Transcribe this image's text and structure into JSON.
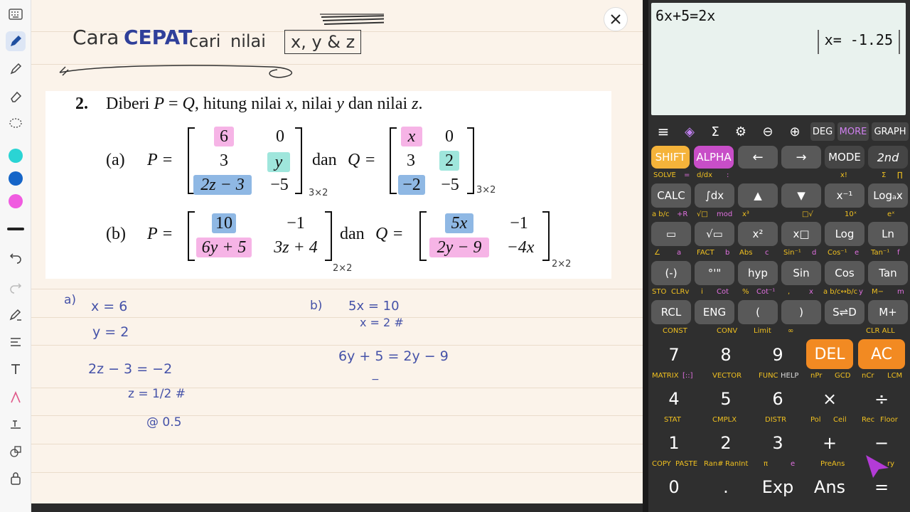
{
  "notes": {
    "title_handwriting": [
      "Cara",
      "CEPAT",
      "cari",
      "nilai",
      "x, y & z"
    ],
    "problem": {
      "number": "2.",
      "statement_parts": [
        "Diberi",
        "P",
        "=",
        "Q",
        ", hitung nilai",
        "x",
        ", nilai",
        "y",
        "dan nilai",
        "z",
        "."
      ],
      "part_a": {
        "label": "(a)",
        "p_label": "P =",
        "dan": "dan",
        "q_label": "Q =",
        "P": [
          "6",
          "0",
          "3",
          "y",
          "2z − 3",
          "−5"
        ],
        "Q": [
          "x",
          "0",
          "3",
          "2",
          "−2",
          "−5"
        ],
        "size_p": "3×2",
        "size_q": "3×2"
      },
      "part_b": {
        "label": "(b)",
        "p_label": "P =",
        "dan": "dan",
        "q_label": "Q =",
        "P": [
          "10",
          "−1",
          "6y + 5",
          "3z + 4"
        ],
        "Q": [
          "5x",
          "−1",
          "2y − 9",
          "−4x"
        ],
        "size_p": "2×2",
        "size_q": "2×2"
      }
    },
    "work_a": [
      "a)",
      "x = 6",
      "y = 2",
      "2z − 3 = −2",
      "z = 1/2 #",
      "@ 0.5"
    ],
    "work_b": [
      "b)",
      "5x = 10",
      "x = 2 #",
      "6y + 5 = 2y − 9",
      "−"
    ]
  },
  "toolbar": {
    "icons": [
      "keyboard-icon",
      "pen-icon",
      "highlighter-icon",
      "eraser-icon",
      "lasso-icon",
      "color-cyan",
      "color-blue",
      "color-pink",
      "stroke-width",
      "undo-icon",
      "redo-icon",
      "pen-settings-icon",
      "text-align-icon",
      "text-tool-icon",
      "shape-icon",
      "textbox-icon",
      "shapes-icon",
      "lock-icon"
    ],
    "colors": {
      "cyan": "#2ad4d4",
      "blue": "#1565c8",
      "pink": "#f05be0"
    }
  },
  "calculator": {
    "expression": "6x+5=2x",
    "result": "x= -1.25",
    "topbar": [
      "≡",
      "◈",
      "Σ",
      "⚙",
      "⊖",
      "⊕",
      "DEG",
      "MORE",
      "GRAPH"
    ],
    "row1": [
      "SHIFT",
      "ALPHA",
      "←",
      "→",
      "MODE",
      "2nd"
    ],
    "row1_labels": [
      "SOLVE",
      "=",
      "d/dx",
      ":",
      "x!",
      "Σ",
      "∏"
    ],
    "row2": [
      "CALC",
      "∫dx",
      "▲",
      "▼",
      "x⁻¹",
      "Logₐx"
    ],
    "row2_labels": [
      "a b/c",
      "+R",
      "√□",
      "mod",
      "x³",
      "□√",
      "10ˣ",
      "eˣ"
    ],
    "row3": [
      "▭",
      "√▭",
      "x²",
      "x□",
      "Log",
      "Ln"
    ],
    "row3_labels": [
      "∠",
      "a",
      "FACT",
      "b",
      "Abs",
      "c",
      "Sin⁻¹",
      "d",
      "Cos⁻¹",
      "e",
      "Tan⁻¹",
      "f"
    ],
    "row4": [
      "(-)",
      "°'\"",
      "hyp",
      "Sin",
      "Cos",
      "Tan"
    ],
    "row4_labels": [
      "STO",
      "CLRv",
      "i",
      "Cot",
      "%",
      "Cot⁻¹",
      ",",
      "x",
      "a b/c↔b/c",
      "y",
      "M−",
      "m"
    ],
    "row5": [
      "RCL",
      "ENG",
      "(",
      ")",
      "S⇌D",
      "M+"
    ],
    "row5_labels": [
      "CONST",
      "CONV",
      "Limit",
      "∞",
      "CLR ALL"
    ],
    "row6": [
      "7",
      "8",
      "9",
      "DEL",
      "AC"
    ],
    "row6_labels": [
      "MATRIX",
      "[::]",
      "VECTOR",
      "FUNC",
      "HELP",
      "nPr",
      "GCD",
      "nCr",
      "LCM"
    ],
    "row7": [
      "4",
      "5",
      "6",
      "×",
      "÷"
    ],
    "row7_labels": [
      "STAT",
      "CMPLX",
      "DISTR",
      "Pol",
      "Ceil",
      "Rec",
      "Floor"
    ],
    "row8": [
      "1",
      "2",
      "3",
      "+",
      "−"
    ],
    "row8_labels": [
      "COPY",
      "PASTE",
      "Ran#",
      "RanInt",
      "π",
      "e",
      "PreAns",
      "ry"
    ],
    "row9": [
      "0",
      ".",
      "Exp",
      "Ans",
      "="
    ]
  }
}
